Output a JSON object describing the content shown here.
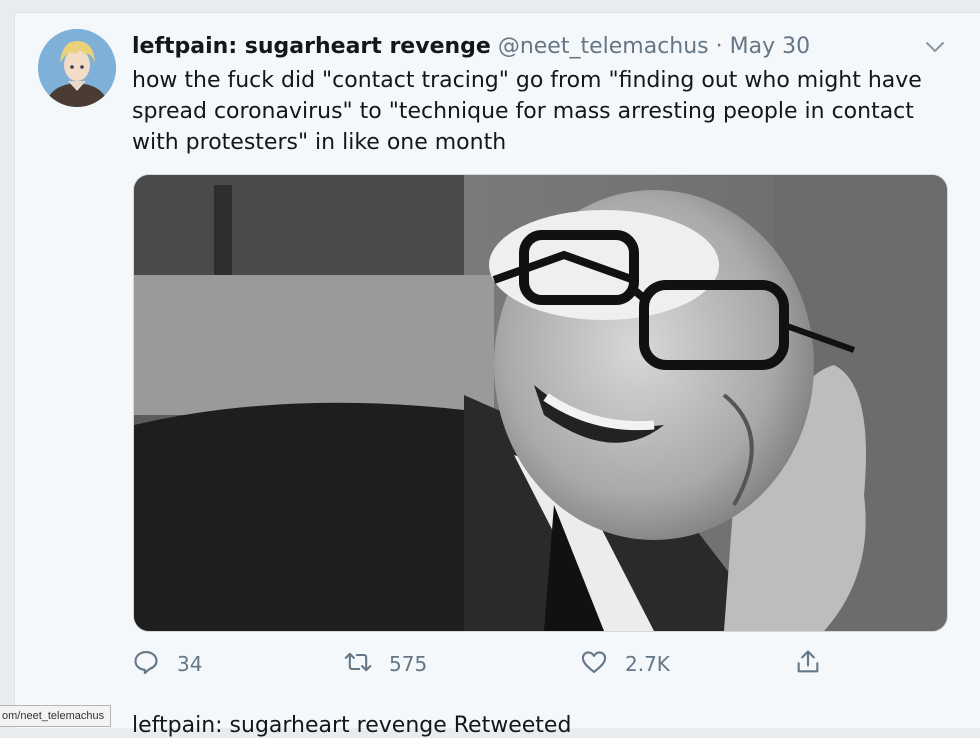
{
  "tweet": {
    "display_name": "leftpain: sugarheart revenge",
    "handle": "@neet_telemachus",
    "separator": "·",
    "date": "May 30",
    "text": "how the fuck did \"contact tracing\" go from \"finding out who might have spread coronavirus\" to \"technique for mass arresting people in contact with protesters\" in like one month",
    "actions": {
      "reply": {
        "icon": "reply-icon",
        "count": "34"
      },
      "retweet": {
        "icon": "retweet-icon",
        "count": "575"
      },
      "like": {
        "icon": "heart-icon",
        "count": "2.7K"
      },
      "share": {
        "icon": "share-icon"
      }
    }
  },
  "next_tweet": {
    "context_line": "leftpain: sugarheart revenge Retweeted"
  },
  "status_bar": {
    "url": "om/neet_telemachus"
  },
  "colors": {
    "primary_text": "#14171a",
    "secondary_text": "#657786",
    "background": "#f5f8fa"
  }
}
